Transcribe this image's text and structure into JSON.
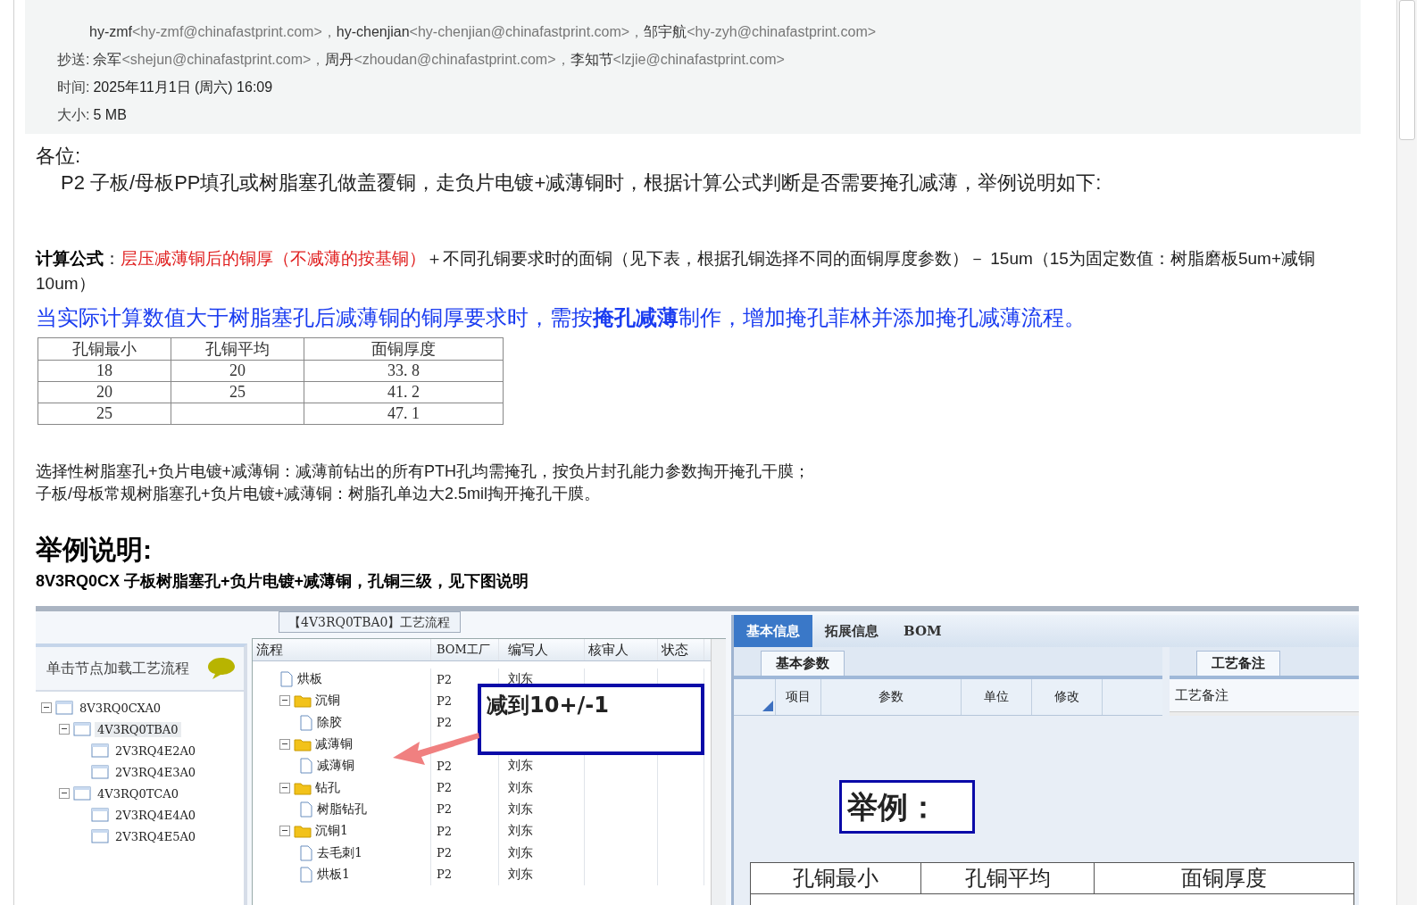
{
  "header": {
    "to_lines": [
      [
        {
          "name": "hy-zmf",
          "addr": "<hy-zmf@chinafastprint.com>，"
        },
        {
          "name": "hy-chenjian",
          "addr": "<hy-chenjian@chinafastprint.com>，"
        },
        {
          "name": "邹宇航",
          "addr": "<hy-zyh@chinafastprint.com>"
        }
      ]
    ],
    "cc": {
      "label": "抄送:",
      "recipients": [
        {
          "name": "佘军",
          "addr": "<shejun@chinafastprint.com>，"
        },
        {
          "name": "周丹",
          "addr": "<zhoudan@chinafastprint.com>，"
        },
        {
          "name": "李知节",
          "addr": "<lzjie@chinafastprint.com>"
        }
      ]
    },
    "fields": [
      {
        "label": "时间:",
        "value": "2025年11月1日 (周六) 16:09"
      },
      {
        "label": "大小:",
        "value": "5 MB"
      }
    ]
  },
  "body": {
    "greeting": "各位:",
    "intro": "P2  子板/母板PP填孔或树脂塞孔做盖覆铜，走负片电镀+减薄铜时，根据计算公式判断是否需要掩孔减薄，举例说明如下:",
    "formula": [
      {
        "kind": "label",
        "text": "计算公式"
      },
      {
        "kind": "plain",
        "text": "："
      },
      {
        "kind": "red",
        "text": "层压减薄铜后的铜厚（不减薄的按基铜）"
      },
      {
        "kind": "plain",
        "text": "＋不同孔铜要求时的面铜（见下表，根据孔铜选择不同的面铜厚度参数）－ 15um（15为固定数值：树脂磨板5um+减铜10um）"
      }
    ],
    "emphasis": "当实际计算数值大于树脂塞孔后减薄铜的铜厚要求时，需按**掩孔减薄**制作，增加掩孔菲林并添加掩孔减薄流程。",
    "table": {
      "columns": [
        "孔铜最小",
        "孔铜平均",
        "面铜厚度"
      ],
      "rows": [
        [
          "18",
          "20",
          "33. 8"
        ],
        [
          "20",
          "25",
          "41. 2"
        ],
        [
          "25",
          "",
          "47. 1"
        ]
      ]
    },
    "notes": [
      "选择性树脂塞孔+负片电镀+减薄铜：减薄前钻出的所有PTH孔均需掩孔，按负片封孔能力参数掏开掩孔干膜；",
      "子板/母板常规树脂塞孔+负片电镀+减薄铜：树脂孔单边大2.5mil掏开掩孔干膜。"
    ],
    "heading": "举例说明:",
    "subheading": "8V3RQ0CX 子板树脂塞孔+负片电镀+减薄铜，孔铜三级，见下图说明"
  },
  "embedded": {
    "title": "【4V3RQ0TBA0】工艺流程",
    "hint": "单击节点加载工艺流程",
    "tree": [
      {
        "label": "8V3RQ0CXA0",
        "selected": false,
        "expanded": true,
        "children": [
          {
            "label": "4V3RQ0TBA0",
            "selected": true,
            "expanded": true,
            "children": [
              {
                "label": "2V3RQ4E2A0",
                "selected": false
              },
              {
                "label": "2V3RQ4E3A0",
                "selected": false
              }
            ]
          },
          {
            "label": "4V3RQ0TCA0",
            "selected": false,
            "expanded": true,
            "children": [
              {
                "label": "2V3RQ4E4A0",
                "selected": false
              },
              {
                "label": "2V3RQ4E5A0",
                "selected": false
              }
            ]
          }
        ]
      }
    ],
    "grid_columns": [
      "流程",
      "BOM工厂",
      "编写人",
      "核审人",
      "状态"
    ],
    "process": [
      {
        "kind": "file",
        "name": "烘板",
        "factory": "P2",
        "writer": "刘东"
      },
      {
        "kind": "folder",
        "name": "沉铜",
        "factory": "P2",
        "expanded": true,
        "children": [
          {
            "kind": "file",
            "name": "除胶",
            "factory": "P2"
          }
        ]
      },
      {
        "kind": "folder",
        "name": "减薄铜",
        "expanded": true,
        "children": [
          {
            "kind": "file",
            "name": "减薄铜",
            "factory": "P2",
            "writer": "刘东"
          }
        ]
      },
      {
        "kind": "folder",
        "name": "钻孔",
        "factory": "P2",
        "writer": "刘东",
        "expanded": true,
        "children": [
          {
            "kind": "file",
            "name": "树脂钻孔",
            "factory": "P2",
            "writer": "刘东"
          }
        ]
      },
      {
        "kind": "folder",
        "name": "沉铜1",
        "factory": "P2",
        "writer": "刘东",
        "expanded": true,
        "children": [
          {
            "kind": "file",
            "name": "去毛刺1",
            "factory": "P2",
            "writer": "刘东"
          },
          {
            "kind": "file",
            "name": "烘板1",
            "factory": "P2",
            "writer": "刘东"
          }
        ]
      }
    ],
    "callout": "减到10+/-1",
    "tabs": [
      {
        "label": "基本信息",
        "selected": true
      },
      {
        "label": "拓展信息",
        "selected": false
      },
      {
        "label": "BOM",
        "selected": false
      }
    ],
    "subtab": "基本参数",
    "param_columns": [
      "项目",
      "参数",
      "单位",
      "修改"
    ],
    "notes_tab": "工艺备注",
    "notes_label": "工艺备注",
    "example_callout": "举例：",
    "overlay_columns": [
      "孔铜最小",
      "孔铜平均",
      "面铜厚度"
    ]
  }
}
